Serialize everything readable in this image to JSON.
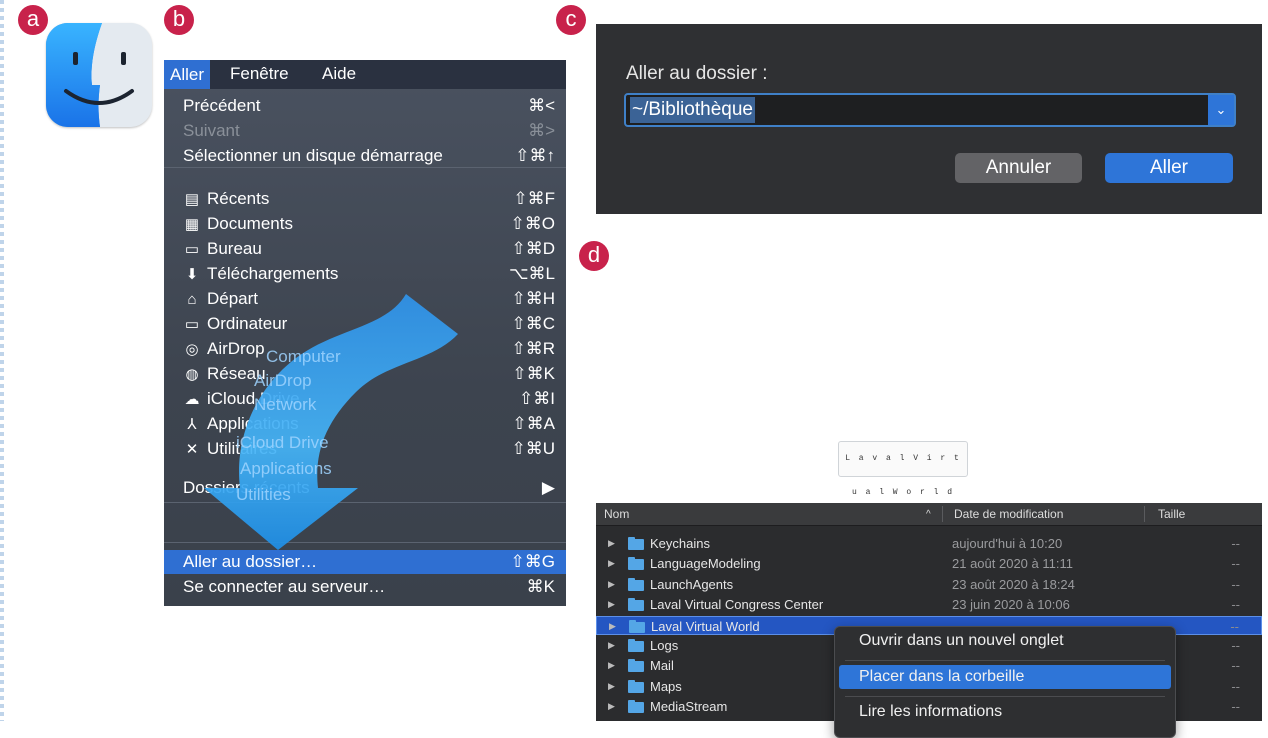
{
  "badges": {
    "a": "a",
    "b": "b",
    "c": "c",
    "d": "d"
  },
  "menu": {
    "bar": [
      "Aller",
      "Fenêtre",
      "Aide"
    ],
    "items": [
      {
        "label": "Précédent",
        "shortcut": "⌘<",
        "icon": ""
      },
      {
        "label": "Suivant",
        "shortcut": "⌘>",
        "icon": "",
        "disabled": true
      },
      {
        "label": "Sélectionner un disque démarrage",
        "shortcut": "⇧⌘↑",
        "icon": ""
      },
      {
        "label": "Récents",
        "shortcut": "⇧⌘F",
        "icon": "▤"
      },
      {
        "label": "Documents",
        "shortcut": "⇧⌘O",
        "icon": "▦"
      },
      {
        "label": "Bureau",
        "shortcut": "⇧⌘D",
        "icon": "▭"
      },
      {
        "label": "Téléchargements",
        "shortcut": "⌥⌘L",
        "icon": "⬇"
      },
      {
        "label": "Départ",
        "shortcut": "⇧⌘H",
        "icon": "⌂"
      },
      {
        "label": "Ordinateur",
        "shortcut": "⇧⌘C",
        "icon": "▭"
      },
      {
        "label": "AirDrop",
        "shortcut": "⇧⌘R",
        "icon": "◎"
      },
      {
        "label": "Réseau",
        "shortcut": "⇧⌘K",
        "icon": "◍"
      },
      {
        "label": "iCloud Drive",
        "shortcut": "⇧⌘I",
        "icon": "☁"
      },
      {
        "label": "Applications",
        "shortcut": "⇧⌘A",
        "icon": "⅄"
      },
      {
        "label": "Utilitaires",
        "shortcut": "⇧⌘U",
        "icon": "✕"
      },
      {
        "label": "Dossiers récents",
        "shortcut": "▶",
        "icon": ""
      },
      {
        "label": "Aller au dossier…",
        "shortcut": "⇧⌘G",
        "icon": "",
        "selected": true
      },
      {
        "label": "Se connecter au serveur…",
        "shortcut": "⌘K",
        "icon": ""
      }
    ],
    "ghost_labels": [
      "Computer",
      "AirDrop",
      "Network",
      "iCloud Drive",
      "Applications",
      "Utilities"
    ]
  },
  "dialog": {
    "title": "Aller au dossier :",
    "field_value": "~/Bibliothèque",
    "cancel": "Annuler",
    "go": "Aller"
  },
  "logo_text": "L a v a l  V i r t u a l  W o r l d",
  "list": {
    "headers": {
      "name": "Nom",
      "sort_arrow": "^",
      "date": "Date de modification",
      "size": "Taille"
    },
    "rows": [
      {
        "name": "Keychains",
        "date": "aujourd'hui à 10:20",
        "size": "--"
      },
      {
        "name": "LanguageModeling",
        "date": "21 août 2020 à 11:11",
        "size": "--"
      },
      {
        "name": "LaunchAgents",
        "date": "23 août 2020 à 18:24",
        "size": "--"
      },
      {
        "name": "Laval Virtual Congress Center",
        "date": "23 juin 2020 à 10:06",
        "size": "--"
      },
      {
        "name": "Laval Virtual World",
        "date": "",
        "size": "--",
        "selected": true
      },
      {
        "name": "Logs",
        "date": "",
        "size": "--"
      },
      {
        "name": "Mail",
        "date": "",
        "size": "--"
      },
      {
        "name": "Maps",
        "date": "",
        "size": "--"
      },
      {
        "name": "MediaStream",
        "date": "",
        "size": "--"
      }
    ]
  },
  "context_menu": {
    "items": [
      "Ouvrir dans un nouvel onglet",
      "Placer dans la corbeille",
      "Lire les informations"
    ]
  },
  "colors": {
    "accent": "#2f6fd2",
    "badge": "#c8224b",
    "arrow": "#2fa3f2",
    "folder": "#54a6e6"
  }
}
